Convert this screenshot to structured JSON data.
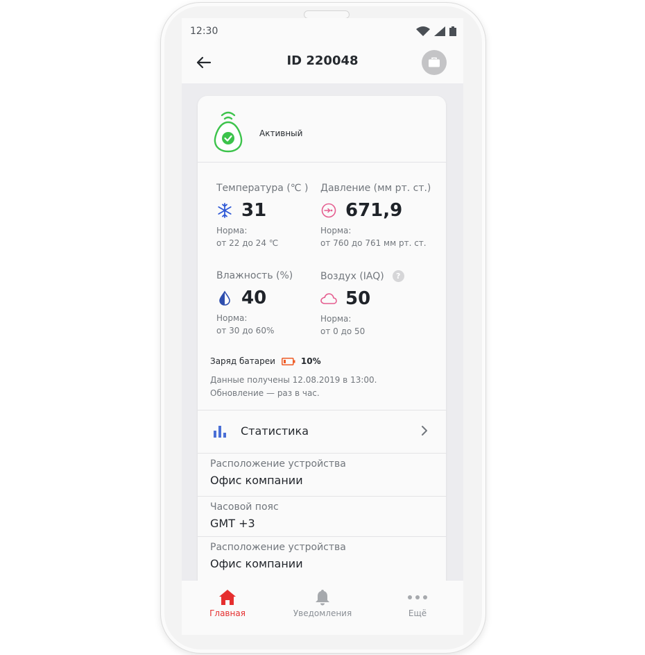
{
  "statusbar": {
    "time": "12:30"
  },
  "appbar": {
    "title": "ID 220048"
  },
  "device": {
    "status": "Активный"
  },
  "metrics": [
    {
      "label": "Температура (℃ )",
      "value": "31",
      "norm_title": "Норма:",
      "norm_range": "от 22 до 24 ℃",
      "icon": "snowflake-icon",
      "color": "#2f59d6"
    },
    {
      "label": "Давление (мм рт. ст.)",
      "value": "671,9",
      "norm_title": "Норма:",
      "norm_range": "от 760 до 761 мм рт. ст.",
      "icon": "gauge-icon",
      "color": "#e55d8f"
    },
    {
      "label": "Влажность (%)",
      "value": "40",
      "norm_title": "Норма:",
      "norm_range": "от 30 до 60%",
      "icon": "drop-icon",
      "color": "#2f4fae"
    },
    {
      "label": "Воздух (IAQ)",
      "value": "50",
      "norm_title": "Норма:",
      "norm_range": "от 0 до 50",
      "icon": "cloud-icon",
      "color": "#e55d8f",
      "help": "?"
    }
  ],
  "battery": {
    "label": "Заряд батареи",
    "percent": "10%",
    "color": "#ee5a24"
  },
  "data_info": {
    "received": "Данные получены 12.08.2019 в 13:00.",
    "update": "Обновление — раз в час."
  },
  "statistics": {
    "label": "Статистика",
    "icon": "bar-chart-icon"
  },
  "info_items": [
    {
      "label": "Расположение устройства",
      "value": "Офис компании"
    },
    {
      "label": "Часовой пояс",
      "value": "GMT +3"
    },
    {
      "label": "Расположение устройства",
      "value": "Офис компании"
    }
  ],
  "nav": [
    {
      "label": "Главная",
      "icon": "home-icon",
      "active": true
    },
    {
      "label": "Уведомления",
      "icon": "bell-icon",
      "active": false
    },
    {
      "label": "Ещё",
      "icon": "more-icon",
      "active": false
    }
  ],
  "colors": {
    "accent": "#e52e2e",
    "active_green": "#3cc34b",
    "text": "#1f2329",
    "muted": "#71767c"
  }
}
